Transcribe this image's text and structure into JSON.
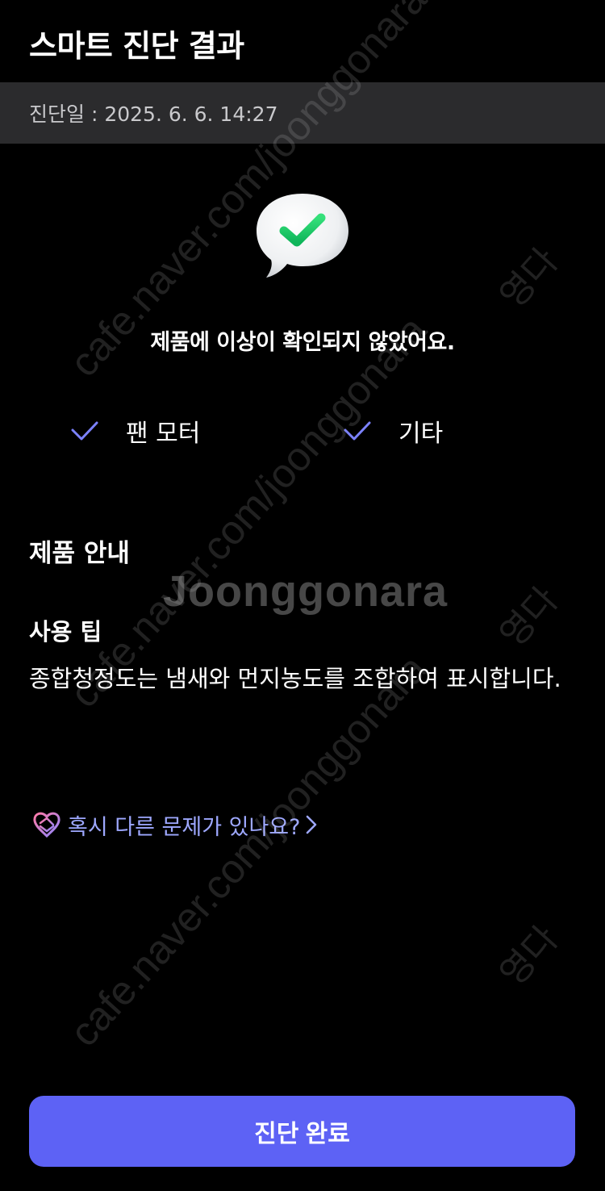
{
  "header": {
    "title": "스마트 진단 결과"
  },
  "diagnosis": {
    "date_label": "진단일 : 2025. 6. 6. 14:27"
  },
  "result": {
    "icon": "check-chat-bubble-icon",
    "message": "제품에 이상이 확인되지 않았어요.",
    "checks": [
      {
        "label": "팬 모터",
        "icon": "check-icon"
      },
      {
        "label": "기타",
        "icon": "check-icon"
      }
    ]
  },
  "guide": {
    "section_title": "제품 안내",
    "tip_title": "사용 팁",
    "tip_body": "종합청정도는 냄새와 먼지농도를 조합하여 표시합니다."
  },
  "help": {
    "link_label": "혹시 다른 문제가 있나요?",
    "icon": "support-icon"
  },
  "footer": {
    "complete_button": "진단 완료"
  },
  "watermark": {
    "url": "cafe.naver.com/joonggonara",
    "logo": "Joonggonara",
    "side": "영다"
  },
  "colors": {
    "background": "#000000",
    "date_bar": "#2b2b2d",
    "accent": "#5d62f5",
    "link": "#9ea8ff",
    "check": "#7c82ff"
  }
}
